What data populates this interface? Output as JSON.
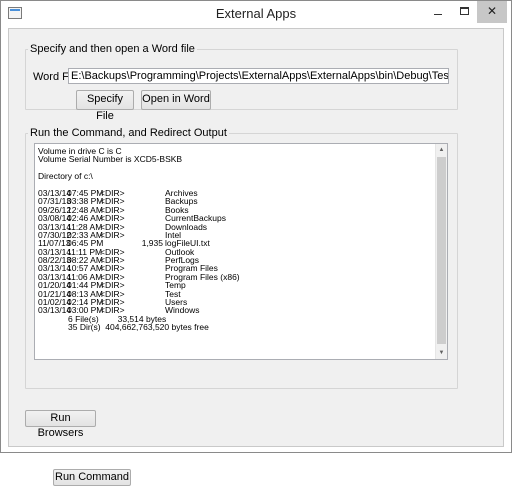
{
  "window": {
    "title": "External Apps",
    "close_glyph": "✕"
  },
  "word_group": {
    "label": "Specify and then open a Word file",
    "field_label": "Word File:",
    "file_path": "E:\\Backups\\Programming\\Projects\\ExternalApps\\ExternalApps\\bin\\Debug\\TestDocument.docx",
    "specify_button": "Specify File",
    "open_button": "Open in Word"
  },
  "command_group": {
    "label": "Run the Command, and Redirect Output",
    "header_lines": [
      "Volume in drive C is C",
      "Volume Serial Number is XCD5-BSKB",
      "",
      "Directory of c:\\",
      ""
    ],
    "rows": [
      {
        "date": "03/13/14",
        "time": "07:45 PM",
        "type": "<DIR>",
        "size": "",
        "name": "Archives"
      },
      {
        "date": "07/31/13",
        "time": "03:38 PM",
        "type": "<DIR>",
        "size": "",
        "name": "Backups"
      },
      {
        "date": "09/26/12",
        "time": "12:48 AM",
        "type": "<DIR>",
        "size": "",
        "name": "Books"
      },
      {
        "date": "03/08/14",
        "time": "02:46 AM",
        "type": "<DIR>",
        "size": "",
        "name": "CurrentBackups"
      },
      {
        "date": "03/13/14",
        "time": "11:28 AM",
        "type": "<DIR>",
        "size": "",
        "name": "Downloads"
      },
      {
        "date": "07/30/12",
        "time": "02:33 AM",
        "type": "<DIR>",
        "size": "",
        "name": "Intel"
      },
      {
        "date": "11/07/13",
        "time": "06:45 PM",
        "type": "",
        "size": "1,935",
        "name": "logFileUI.txt"
      },
      {
        "date": "03/13/14",
        "time": "11:11 PM",
        "type": "<DIR>",
        "size": "",
        "name": "Outlook"
      },
      {
        "date": "08/22/13",
        "time": "08:22 AM",
        "type": "<DIR>",
        "size": "",
        "name": "PerfLogs"
      },
      {
        "date": "03/13/14",
        "time": "10:57 AM",
        "type": "<DIR>",
        "size": "",
        "name": "Program Files"
      },
      {
        "date": "03/13/14",
        "time": "11:06 AM",
        "type": "<DIR>",
        "size": "",
        "name": "Program Files (x86)"
      },
      {
        "date": "01/20/14",
        "time": "01:44 PM",
        "type": "<DIR>",
        "size": "",
        "name": "Temp"
      },
      {
        "date": "01/21/14",
        "time": "08:13 AM",
        "type": "<DIR>",
        "size": "",
        "name": "Test"
      },
      {
        "date": "01/02/14",
        "time": "02:14 PM",
        "type": "<DIR>",
        "size": "",
        "name": "Users"
      },
      {
        "date": "03/13/14",
        "time": "03:00 PM",
        "type": "<DIR>",
        "size": "",
        "name": "Windows"
      }
    ],
    "summary_files": "6 File(s)        33,514 bytes",
    "summary_dirs": "35 Dir(s)  404,662,763,520 bytes free",
    "run_button": "Run Command"
  },
  "footer": {
    "browsers_button": "Run Browsers"
  }
}
